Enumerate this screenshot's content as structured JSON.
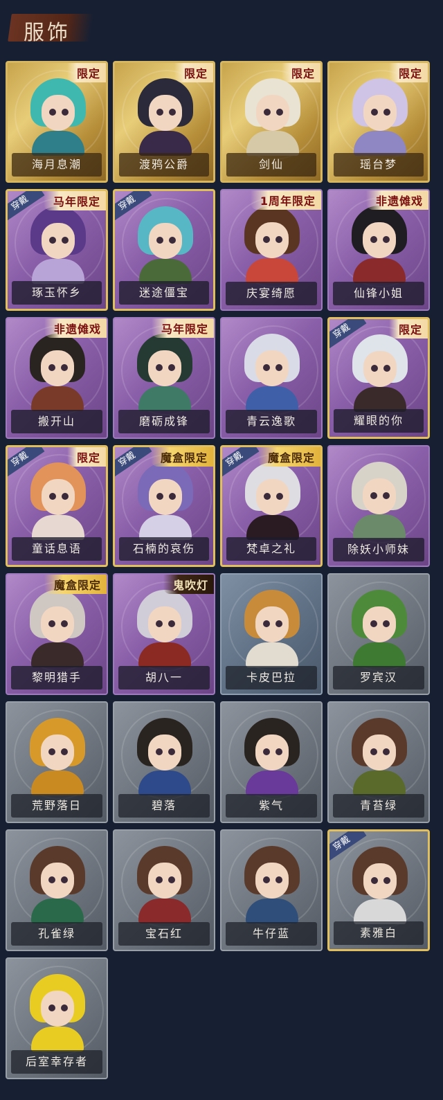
{
  "header": {
    "title": "服饰"
  },
  "colors": {
    "background": "#172033",
    "gold": "#d6b660",
    "purple": "#8a5fa9",
    "gray": "#707780"
  },
  "cards": [
    {
      "name": "海月息潮",
      "tag": "限定",
      "worn": "",
      "style": "gold",
      "hair": "#3fb9b0",
      "body": "#2f7f8a"
    },
    {
      "name": "渡鸦公爵",
      "tag": "限定",
      "worn": "",
      "style": "gold",
      "hair": "#2a2a3a",
      "body": "#3a2a4a"
    },
    {
      "name": "剑仙",
      "tag": "限定",
      "worn": "",
      "style": "gold",
      "hair": "#e8e3d2",
      "body": "#d6c9a8"
    },
    {
      "name": "瑶台梦",
      "tag": "限定",
      "worn": "",
      "style": "gold",
      "hair": "#cfc4e6",
      "body": "#8f86c4"
    },
    {
      "name": "琢玉怀乡",
      "tag": "马年限定",
      "worn": "穿戴",
      "style": "purple",
      "hair": "#5b3a8a",
      "body": "#b9a4d8"
    },
    {
      "name": "迷途僵宝",
      "tag": "",
      "worn": "穿戴",
      "style": "purple",
      "hair": "#58b7c4",
      "body": "#4a6a3a"
    },
    {
      "name": "庆宴绮愿",
      "tag": "1周年限定",
      "worn": "",
      "style": "purple",
      "hair": "#5a3522",
      "body": "#c9473a"
    },
    {
      "name": "仙锋小姐",
      "tag": "非遗傩戏",
      "worn": "",
      "style": "purple",
      "hair": "#1f1c22",
      "body": "#8a2a2a"
    },
    {
      "name": "搬开山",
      "tag": "非遗傩戏",
      "worn": "",
      "style": "purple",
      "hair": "#2a2420",
      "body": "#7a3a2a"
    },
    {
      "name": "磨砺成锋",
      "tag": "马年限定",
      "worn": "",
      "style": "purple",
      "hair": "#253a32",
      "body": "#3e7a66"
    },
    {
      "name": "青云逸歌",
      "tag": "",
      "worn": "",
      "style": "purple",
      "hair": "#d9dbe6",
      "body": "#3f5fa8"
    },
    {
      "name": "耀眼的你",
      "tag": "限定",
      "worn": "穿戴",
      "style": "purple",
      "hair": "#dfe3ea",
      "body": "#3a2a2a"
    },
    {
      "name": "童话息语",
      "tag": "限定",
      "worn": "穿戴",
      "style": "purple",
      "hair": "#e2935a",
      "body": "#e8d8d2"
    },
    {
      "name": "石楠的哀伤",
      "tag": "魔盒限定",
      "worn": "穿戴",
      "style": "purple",
      "hair": "#7a6ab8",
      "body": "#d6d0e6"
    },
    {
      "name": "梵卓之礼",
      "tag": "魔盒限定",
      "worn": "穿戴",
      "style": "purple",
      "hair": "#dedde2",
      "body": "#2a1a22"
    },
    {
      "name": "除妖小师妹",
      "tag": "",
      "worn": "",
      "style": "purple",
      "hair": "#d8d3c9",
      "body": "#6a8a6a"
    },
    {
      "name": "黎明猎手",
      "tag": "魔盒限定",
      "worn": "",
      "style": "purple",
      "hair": "#cfc8c2",
      "body": "#3a2a2a"
    },
    {
      "name": "胡八一",
      "tag": "鬼吹灯",
      "worn": "",
      "style": "purple",
      "hair": "#d0ccd8",
      "body": "#8a2a22"
    },
    {
      "name": "卡皮巴拉",
      "tag": "",
      "worn": "",
      "style": "gray-blue",
      "hair": "#c88b3a",
      "body": "#e2dcd0"
    },
    {
      "name": "罗宾汉",
      "tag": "",
      "worn": "",
      "style": "gray",
      "hair": "#4d8a3a",
      "body": "#3f7a32"
    },
    {
      "name": "荒野落日",
      "tag": "",
      "worn": "",
      "style": "gray",
      "hair": "#d79a2a",
      "body": "#c98a22"
    },
    {
      "name": "碧落",
      "tag": "",
      "worn": "",
      "style": "gray",
      "hair": "#2a2420",
      "body": "#2f4a8a"
    },
    {
      "name": "紫气",
      "tag": "",
      "worn": "",
      "style": "gray",
      "hair": "#2a2420",
      "body": "#6a3a9a"
    },
    {
      "name": "青苔绿",
      "tag": "",
      "worn": "",
      "style": "gray",
      "hair": "#5a3a2a",
      "body": "#5a6a2a"
    },
    {
      "name": "孔雀绿",
      "tag": "",
      "worn": "",
      "style": "gray",
      "hair": "#5a3a2a",
      "body": "#2a6a4a"
    },
    {
      "name": "宝石红",
      "tag": "",
      "worn": "",
      "style": "gray",
      "hair": "#5a3a2a",
      "body": "#8a2a2a"
    },
    {
      "name": "牛仔蓝",
      "tag": "",
      "worn": "",
      "style": "gray",
      "hair": "#5a3a2a",
      "body": "#2f4f7a"
    },
    {
      "name": "素雅白",
      "tag": "",
      "worn": "穿戴",
      "style": "gray",
      "hair": "#5a3a2a",
      "body": "#d8d8d8"
    },
    {
      "name": "后室幸存者",
      "tag": "",
      "worn": "",
      "style": "gray",
      "hair": "#e8cc22",
      "body": "#e8cc22"
    }
  ]
}
